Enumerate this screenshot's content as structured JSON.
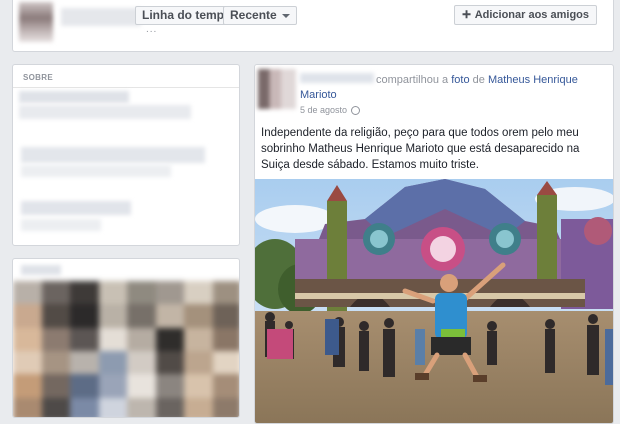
{
  "timeline": {
    "filter_label": "Linha do tempo",
    "sort_label": "Recente",
    "add_friend_label": "Adicionar aos amigos",
    "add_friend_icon": "plus-icon",
    "more_dots": "..."
  },
  "about": {
    "title": "SOBRE"
  },
  "post": {
    "action_text": "compartilhou a",
    "photo_word": "foto",
    "of_word": "de",
    "author_link": "Matheus Henrique Marioto",
    "date": "5 de agosto",
    "privacy_icon": "globe-icon",
    "body": "Independente da religião, peço para que todos orem pelo meu sobrinho Matheus Henrique Marioto que está desaparecido na Suiça desde sábado. Estamos muito triste."
  },
  "colors": {
    "link": "#365899",
    "background": "#e9ebee",
    "muted": "#90949c"
  }
}
